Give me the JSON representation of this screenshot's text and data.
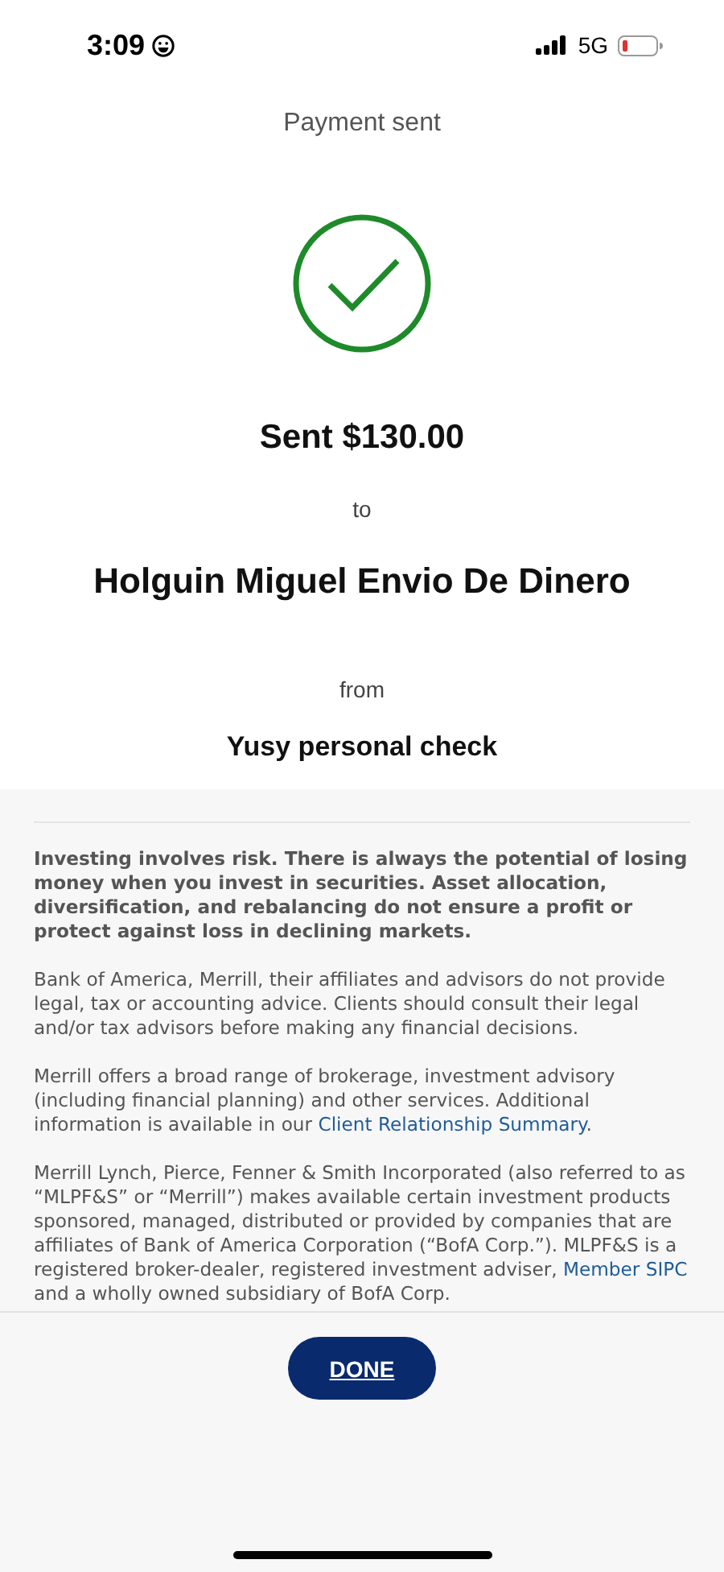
{
  "status_bar": {
    "time": "3:09",
    "network": "5G"
  },
  "header": {
    "title": "Payment sent"
  },
  "confirmation": {
    "amount": "Sent $130.00",
    "to_label": "to",
    "recipient": "Holguin Miguel Envio De Dinero",
    "from_label": "from",
    "account": "Yusy personal check"
  },
  "disclosures": [
    {
      "bold": true,
      "parts": [
        {
          "kind": "text",
          "text": "Investing involves risk. There is always the potential of losing money when you invest in securities. Asset allocation, diversification, and rebalancing do not ensure a profit or protect against loss in declining markets."
        }
      ]
    },
    {
      "bold": false,
      "parts": [
        {
          "kind": "text",
          "text": "Bank of America, Merrill, their affiliates and advisors do not provide legal, tax or accounting advice. Clients should consult their legal and/or tax advisors before making any financial decisions."
        }
      ]
    },
    {
      "bold": false,
      "parts": [
        {
          "kind": "text",
          "text": "Merrill offers a broad range of brokerage, investment advisory (including financial planning) and other services. Additional information is available in our "
        },
        {
          "kind": "link",
          "text": "Client Relationship Summary"
        },
        {
          "kind": "text",
          "text": "."
        }
      ]
    },
    {
      "bold": false,
      "parts": [
        {
          "kind": "text",
          "text": "Merrill Lynch, Pierce, Fenner & Smith Incorporated (also referred to as “MLPF&S” or “Merrill”) makes available certain investment products sponsored, managed, distributed or provided by companies that are affiliates of Bank of America Corporation (“BofA Corp.”). MLPF&S is a registered broker-dealer, registered investment adviser, "
        },
        {
          "kind": "link",
          "text": "Member SIPC"
        },
        {
          "kind": "text",
          "text": " and a wholly owned subsidiary of BofA Corp."
        }
      ]
    }
  ],
  "footer": {
    "button": "DONE"
  }
}
